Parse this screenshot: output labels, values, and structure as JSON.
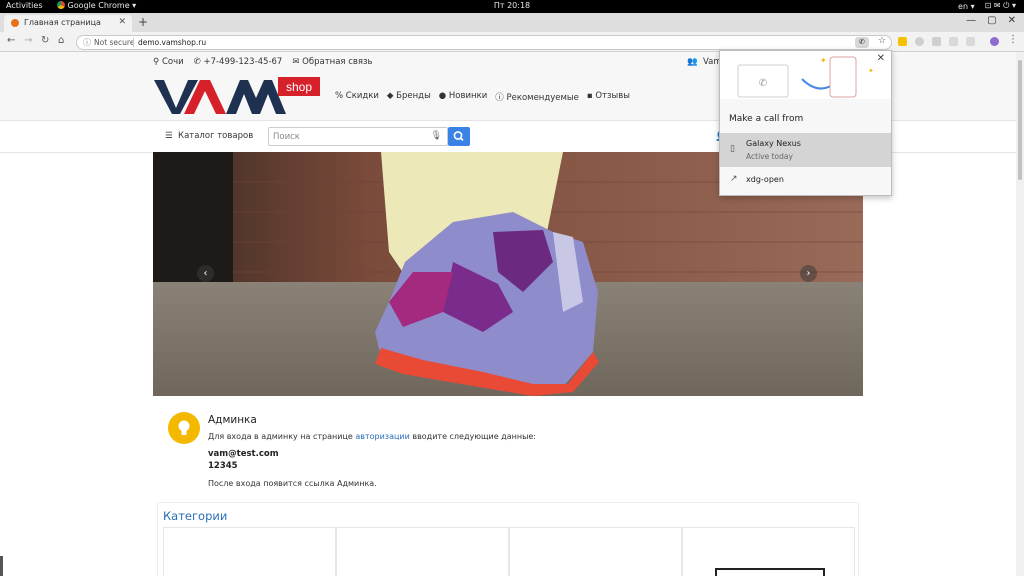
{
  "os_bar": {
    "activities": "Activities",
    "app_menu": "Google Chrome ▾",
    "clock": "Пт 20:18",
    "lang": "en ▾",
    "system_icons": "⊡ ✉ ⏻ ▾"
  },
  "browser": {
    "tab_title": "Главная страница",
    "tab_close": "✕",
    "new_tab": "+",
    "window_controls": [
      "—",
      "▢",
      "✕"
    ],
    "not_secure": "Not secure",
    "url": "demo.vamshop.ru",
    "info_icon": "ⓘ",
    "phone_chip_icon": "✆",
    "bookmark_icon": "☆",
    "menu_icon": "⋮",
    "nav_icons": [
      "←",
      "→",
      "↻",
      "⌂"
    ],
    "ext_colors": [
      "#f2c200",
      "#cfcfcf",
      "#cfcfcf",
      "#d9d9d9",
      "#d9d9d9",
      "#8d6bd1"
    ]
  },
  "site": {
    "city": "Сочи",
    "phone": "+7-499-123-45-67",
    "feedback": "Обратная связь",
    "user_short": "Vam",
    "logo_text": "VAM",
    "logo_badge": "shop",
    "nav": [
      {
        "icon": "%",
        "label": "Скидки"
      },
      {
        "icon": "◆",
        "label": "Бренды"
      },
      {
        "icon": "●",
        "label": "Новинки"
      },
      {
        "icon": "ⓘ",
        "label": "Рекомендуемые"
      },
      {
        "icon": "▪",
        "label": "Отзывы"
      }
    ],
    "catalog": "Каталог товаров",
    "search_placeholder": "Поиск",
    "slider_prev": "‹",
    "slider_next": "›",
    "admin": {
      "title": "Админка",
      "line1_before": "Для входа в админку на странице ",
      "line1_link": "авторизации",
      "line1_after": " вводите следующие данные:",
      "email": "vam@test.com",
      "password": "12345",
      "note": "После входа появится ссылка Админка."
    },
    "categories_title": "Категории",
    "colors": {
      "accent_blue": "#3b82e6",
      "logo_red": "#d6202a",
      "logo_navy": "#1e3150",
      "bulb_yellow": "#f5b800"
    }
  },
  "call_popup": {
    "title": "Make a call from",
    "close": "✕",
    "device_name": "Galaxy Nexus",
    "device_status": "Active today",
    "other_option": "xdg-open",
    "device_icon": "▯",
    "open_icon": "↗"
  }
}
